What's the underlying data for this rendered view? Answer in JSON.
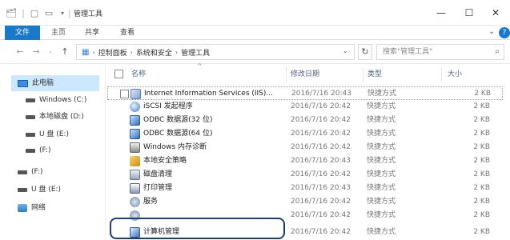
{
  "window": {
    "title": "管理工具",
    "controls": {
      "minimize": "—",
      "maximize": "☐",
      "close": "✕"
    }
  },
  "ribbon": {
    "tabs": [
      "文件",
      "主页",
      "共享",
      "查看"
    ],
    "expand_icon": "chevron-down-icon",
    "help_glyph": "?"
  },
  "address": {
    "breadcrumbs": [
      "控制面板",
      "系统和安全",
      "管理工具"
    ],
    "search_placeholder": "搜索\"管理工具\""
  },
  "nav": {
    "items": [
      {
        "label": "此电脑",
        "icon": "pc-icon",
        "selected": true
      },
      {
        "label": "Windows (C:)",
        "icon": "drive-icon"
      },
      {
        "label": "本地磁盘 (D:)",
        "icon": "drive-icon"
      },
      {
        "label": "U 盘 (E:)",
        "icon": "drive-icon"
      },
      {
        "label": "(F:)",
        "icon": "drive-icon"
      },
      {
        "label": "(F:)",
        "icon": "drive-icon"
      },
      {
        "label": "U 盘 (E:)",
        "icon": "drive-icon"
      },
      {
        "label": "网络",
        "icon": "network-icon"
      }
    ]
  },
  "columns": {
    "name": "名称",
    "date": "修改日期",
    "type": "类型",
    "size": "大小"
  },
  "files": [
    {
      "name": "Internet Information Services (IIS)...",
      "date": "2016/7/16 20:43",
      "type": "快捷方式",
      "size": "2 KB",
      "icon": "ic-iis"
    },
    {
      "name": "iSCSI 发起程序",
      "date": "2016/7/16 20:42",
      "type": "快捷方式",
      "size": "2 KB",
      "icon": "ic-iscsi"
    },
    {
      "name": "ODBC 数据源(32 位)",
      "date": "2016/7/16 20:42",
      "type": "快捷方式",
      "size": "2 KB",
      "icon": "ic-odbc"
    },
    {
      "name": "ODBC 数据源(64 位)",
      "date": "2016/7/16 20:42",
      "type": "快捷方式",
      "size": "2 KB",
      "icon": "ic-odbc"
    },
    {
      "name": "Windows 内存诊断",
      "date": "2016/7/16 20:42",
      "type": "快捷方式",
      "size": "2 KB",
      "icon": "ic-mem"
    },
    {
      "name": "本地安全策略",
      "date": "2016/7/16 20:43",
      "type": "快捷方式",
      "size": "2 KB",
      "icon": "ic-sec"
    },
    {
      "name": "磁盘清理",
      "date": "2016/7/16 20:42",
      "type": "快捷方式",
      "size": "2 KB",
      "icon": "ic-disk"
    },
    {
      "name": "打印管理",
      "date": "2016/7/16 20:43",
      "type": "快捷方式",
      "size": "2 KB",
      "icon": "ic-print"
    },
    {
      "name": "服务",
      "date": "2016/7/16 20:42",
      "type": "快捷方式",
      "size": "2 KB",
      "icon": "ic-svc"
    },
    {
      "name": "",
      "date": "2016/7/16 20:42",
      "type": "快捷方式",
      "size": "2 KB",
      "icon": "ic-svc"
    },
    {
      "name": "计算机管理",
      "date": "2016/7/16 20:42",
      "type": "快捷方式",
      "size": "2 KB",
      "icon": "ic-comp"
    }
  ]
}
